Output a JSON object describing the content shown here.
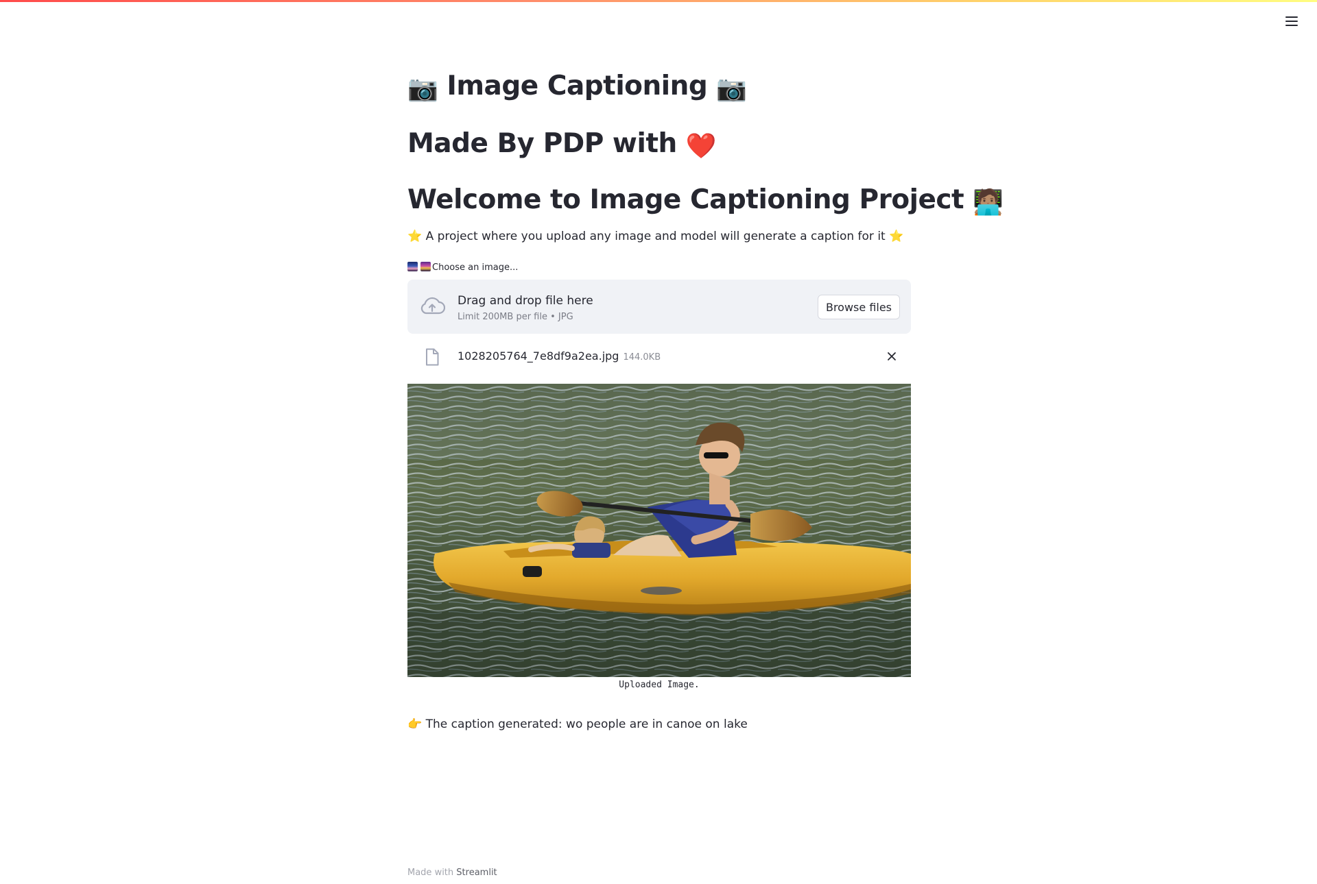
{
  "header": {
    "title": "Image Captioning",
    "title_emoji": "📷",
    "subtitle": "Made By PDP with",
    "subtitle_emoji": "❤️",
    "welcome": "Welcome to Image Captioning Project",
    "welcome_emoji": "🧑🏽‍💻"
  },
  "description": {
    "text": "A project where you upload any image and model will generate a caption for it",
    "star": "⭐"
  },
  "uploader": {
    "label": "Choose an image...",
    "drop_text": "Drag and drop file here",
    "limit_text": "Limit 200MB per file • JPG",
    "browse_label": "Browse files",
    "file_name": "1028205764_7e8df9a2ea.jpg",
    "file_size": "144.0KB"
  },
  "image": {
    "caption": "Uploaded Image."
  },
  "result": {
    "pointer": "👉",
    "text": "The caption generated: wo people are in canoe on lake"
  },
  "footer": {
    "prefix": "Made with",
    "brand": "Streamlit"
  },
  "colors": {
    "text": "#262730",
    "dropzone_bg": "#f0f2f6",
    "accent_gradient_start": "#ff4b4b",
    "accent_gradient_end": "#fffd80"
  }
}
